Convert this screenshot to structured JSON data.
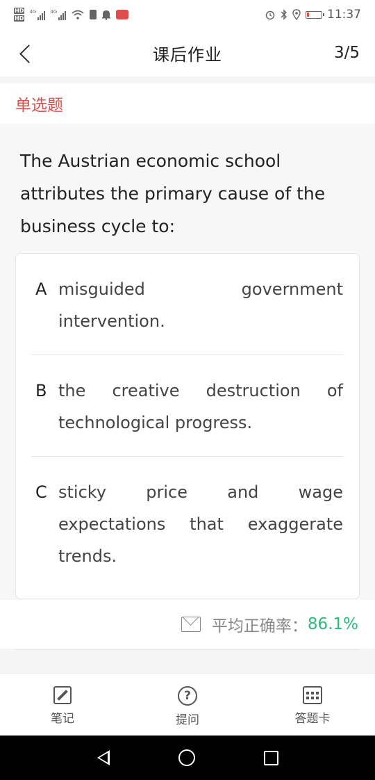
{
  "status_bar": {
    "hd_top": "HD",
    "hd_bottom": "HD",
    "signal1_label": "4G",
    "signal2_label": "4G",
    "time": "11:37"
  },
  "header": {
    "title": "课后作业",
    "page": "3/5"
  },
  "question": {
    "type": "单选题",
    "text": "The Austrian economic school attributes the primary cause of the business cycle to:",
    "options": [
      {
        "letter": "A",
        "text": "misguided government intervention."
      },
      {
        "letter": "B",
        "text": "the creative destruction of technological progress."
      },
      {
        "letter": "C",
        "text": "sticky price and wage expectations that exaggerate trends."
      }
    ]
  },
  "accuracy": {
    "label": "平均正确率：",
    "value": "86.1%",
    "value_color": "#2db87d"
  },
  "toolbar": {
    "notes_label": "笔记",
    "ask_label": "提问",
    "answer_card_label": "答题卡",
    "ask_glyph": "?"
  },
  "colors": {
    "question_type": "#d9534f",
    "accent_green": "#2db87d"
  },
  "icons": [
    "back-icon",
    "mail-icon",
    "note-icon",
    "question-icon",
    "answer-card-icon",
    "nav-back-icon",
    "nav-home-icon",
    "nav-recent-icon"
  ]
}
